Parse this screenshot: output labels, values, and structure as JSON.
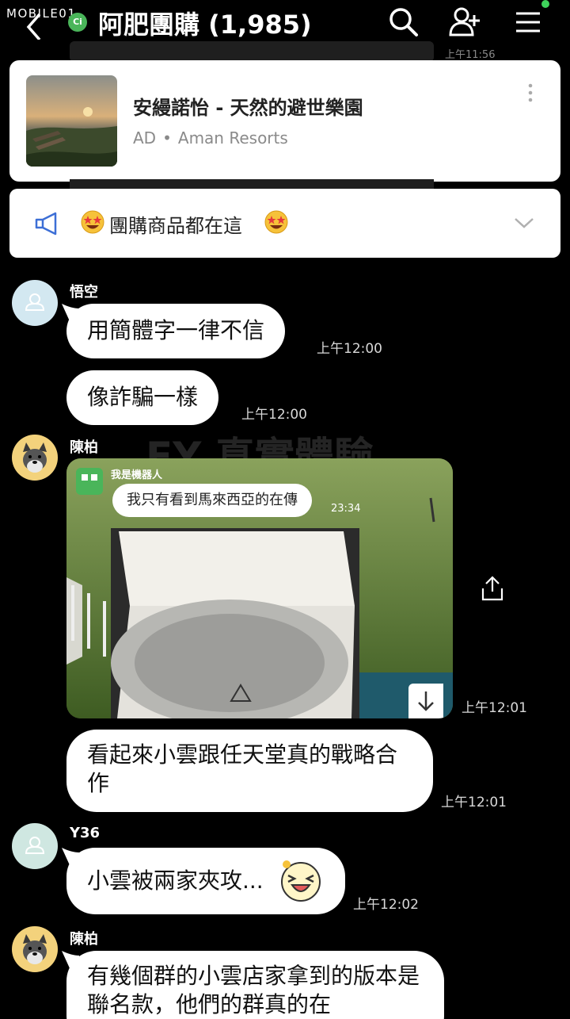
{
  "watermark": "MOBILE01",
  "header": {
    "title": "阿肥團購 (1,985)",
    "group_badge": "Ci"
  },
  "ad": {
    "title": "安縵諾怡 - 天然的避世樂園",
    "label": "AD",
    "separator": "•",
    "advertiser": "Aman Resorts"
  },
  "ghost_time": "上午11:56",
  "announcement": {
    "text": "團購商品都在這"
  },
  "background_watermark": "FY 真實體驗",
  "messages": [
    {
      "sender": "悟空",
      "text": "用簡體字一律不信",
      "time": "上午12:00"
    },
    {
      "text": "像詐騙一樣",
      "time": "上午12:00"
    },
    {
      "sender": "陳柏",
      "image": {
        "inner_sender": "我是機器人",
        "inner_text": "我只有看到馬來西亞的在傳",
        "inner_time": "23:34"
      },
      "time": "上午12:01"
    },
    {
      "text": "看起來小雲跟任天堂真的戰略合作",
      "time": "上午12:01"
    },
    {
      "sender": "Y36",
      "text": "小雲被兩家夾攻...",
      "time": "上午12:02"
    },
    {
      "sender": "陳柏",
      "text": "有幾個群的小雲店家拿到的版本是聯名款，他們的群真的在"
    }
  ],
  "colors": {
    "background": "#000000",
    "bubble": "#ffffff",
    "online": "#3ed35b",
    "badge": "#4ab55a"
  },
  "icons": [
    "back-arrow-icon",
    "search-icon",
    "add-friend-icon",
    "menu-icon",
    "more-vertical-icon",
    "megaphone-icon",
    "chevron-down-icon",
    "share-icon",
    "download-icon",
    "user-silhouette-icon",
    "dog-avatar-icon",
    "laughing-emoji-icon"
  ]
}
